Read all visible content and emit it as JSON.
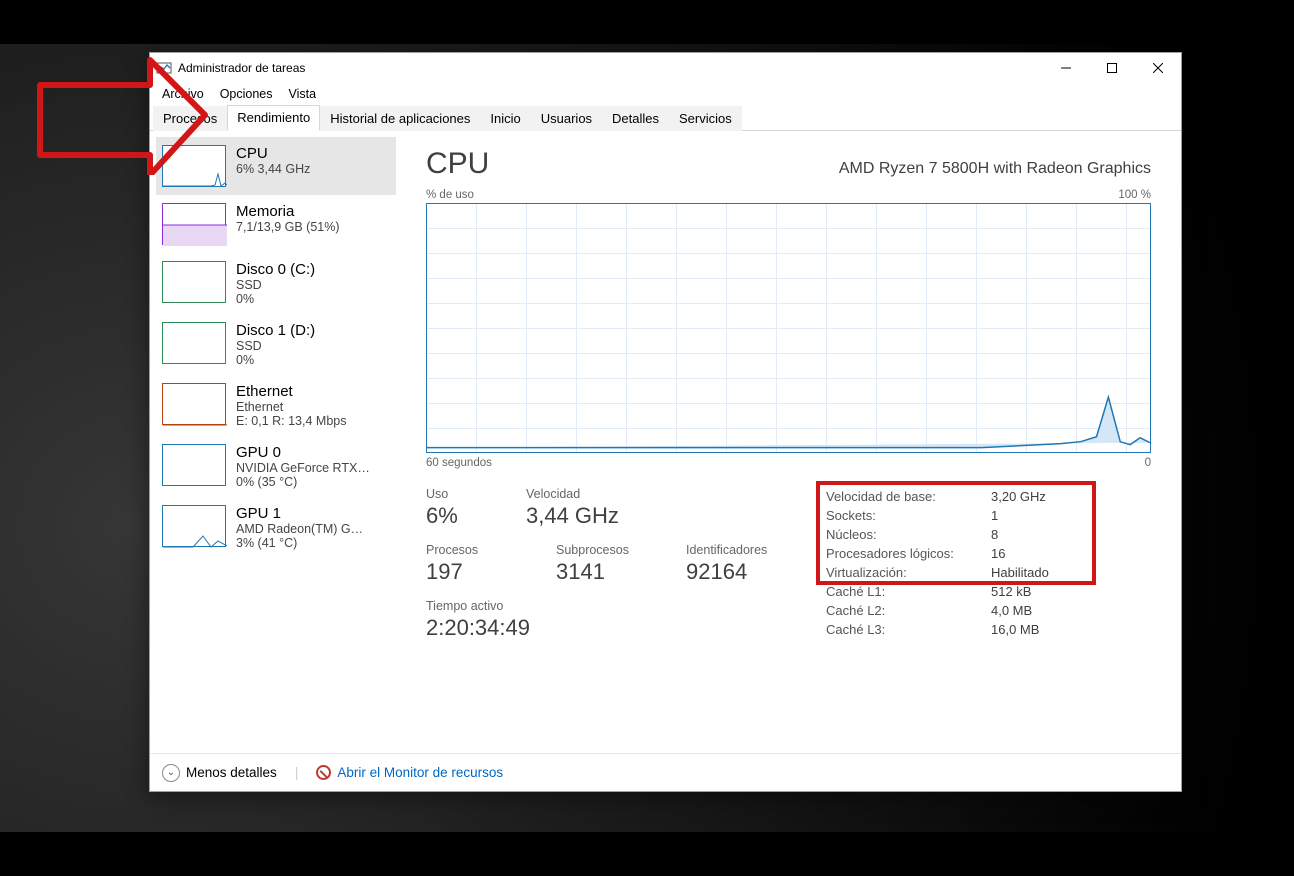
{
  "window": {
    "title": "Administrador de tareas"
  },
  "menubar": [
    "Archivo",
    "Opciones",
    "Vista"
  ],
  "tabs": [
    {
      "label": "Procesos",
      "active": false
    },
    {
      "label": "Rendimiento",
      "active": true
    },
    {
      "label": "Historial de aplicaciones",
      "active": false
    },
    {
      "label": "Inicio",
      "active": false
    },
    {
      "label": "Usuarios",
      "active": false
    },
    {
      "label": "Detalles",
      "active": false
    },
    {
      "label": "Servicios",
      "active": false
    }
  ],
  "sidebar": {
    "items": [
      {
        "title": "CPU",
        "line2": "6% 3,44 GHz",
        "line3": "",
        "thumb": "cpu",
        "selected": true
      },
      {
        "title": "Memoria",
        "line2": "7,1/13,9 GB (51%)",
        "line3": "",
        "thumb": "mem",
        "selected": false
      },
      {
        "title": "Disco 0 (C:)",
        "line2": "SSD",
        "line3": "0%",
        "thumb": "disk",
        "selected": false
      },
      {
        "title": "Disco 1 (D:)",
        "line2": "SSD",
        "line3": "0%",
        "thumb": "disk",
        "selected": false
      },
      {
        "title": "Ethernet",
        "line2": "Ethernet",
        "line3": "E: 0,1 R: 13,4 Mbps",
        "thumb": "net",
        "selected": false
      },
      {
        "title": "GPU 0",
        "line2": "NVIDIA GeForce RTX…",
        "line3": "0%  (35 °C)",
        "thumb": "gpu",
        "selected": false
      },
      {
        "title": "GPU 1",
        "line2": "AMD Radeon(TM) G…",
        "line3": "3%  (41 °C)",
        "thumb": "gpu",
        "selected": false
      }
    ]
  },
  "main": {
    "heading": "CPU",
    "model": "AMD Ryzen 7 5800H with Radeon Graphics",
    "chart": {
      "y_label_left": "% de uso",
      "y_label_right": "100 %",
      "x_label_left": "60 segundos",
      "x_label_right": "0"
    },
    "left_stats": {
      "row1": {
        "labels": [
          "Uso",
          "Velocidad"
        ],
        "values": [
          "6%",
          "3,44 GHz"
        ]
      },
      "row2": {
        "labels": [
          "Procesos",
          "Subprocesos",
          "Identificadores"
        ],
        "values": [
          "197",
          "3141",
          "92164"
        ]
      },
      "uptime_label": "Tiempo activo",
      "uptime_value": "2:20:34:49"
    },
    "right_stats": [
      {
        "k": "Velocidad de base:",
        "v": "3,20 GHz"
      },
      {
        "k": "Sockets:",
        "v": "1"
      },
      {
        "k": "Núcleos:",
        "v": "8"
      },
      {
        "k": "Procesadores lógicos:",
        "v": "16"
      },
      {
        "k": "Virtualización:",
        "v": "Habilitado"
      },
      {
        "k": "Caché L1:",
        "v": "512 kB"
      },
      {
        "k": "Caché L2:",
        "v": "4,0 MB"
      },
      {
        "k": "Caché L3:",
        "v": "16,0 MB"
      }
    ]
  },
  "footer": {
    "less_details": "Menos detalles",
    "open_monitor": "Abrir el Monitor de recursos"
  },
  "chart_data": {
    "type": "line",
    "title": "CPU % de uso",
    "xlabel": "segundos",
    "ylabel": "% de uso",
    "x_range_seconds": [
      60,
      0
    ],
    "ylim": [
      0,
      100
    ],
    "x": [
      60,
      55,
      50,
      45,
      40,
      35,
      30,
      25,
      20,
      15,
      10,
      5,
      4,
      3,
      2,
      1,
      0
    ],
    "values": [
      2,
      2,
      2,
      2,
      2,
      2,
      2,
      2,
      2,
      2,
      2,
      4,
      6,
      22,
      6,
      4,
      5
    ]
  }
}
